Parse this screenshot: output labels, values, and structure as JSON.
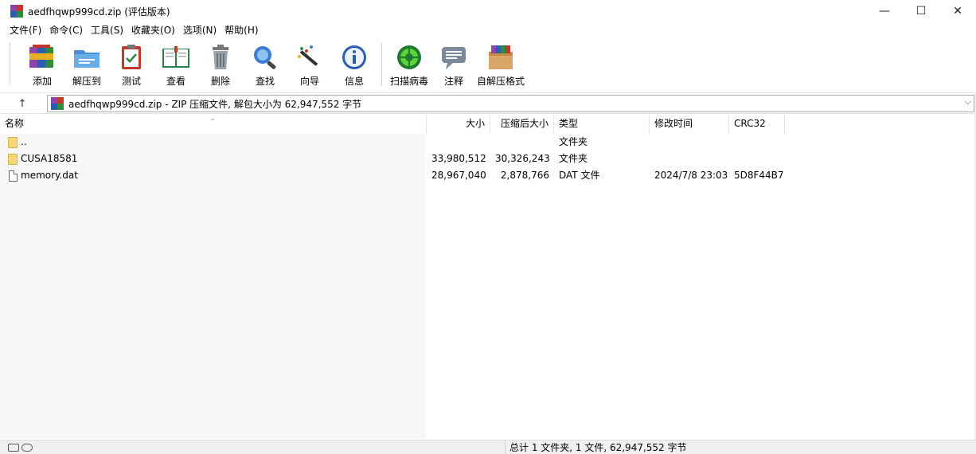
{
  "window": {
    "title": "aedfhqwp999cd.zip (评估版本)",
    "minimize": "—",
    "maximize": "☐",
    "close": "✕"
  },
  "menu": [
    "文件(F)",
    "命令(C)",
    "工具(S)",
    "收藏夹(O)",
    "选项(N)",
    "帮助(H)"
  ],
  "toolbar": {
    "add": "添加",
    "extract": "解压到",
    "test": "测试",
    "view": "查看",
    "delete": "删除",
    "find": "查找",
    "wizard": "向导",
    "info": "信息",
    "scan": "扫描病毒",
    "comment": "注释",
    "sfx": "自解压格式"
  },
  "address": {
    "up": "↑",
    "text": "aedfhqwp999cd.zip - ZIP 压缩文件, 解包大小为 62,947,552 字节",
    "dropdown": "⌵"
  },
  "columns": {
    "name": "名称",
    "size": "大小",
    "packed": "压缩后大小",
    "type": "类型",
    "modified": "修改时间",
    "crc": "CRC32"
  },
  "rows": [
    {
      "name": "..",
      "size": "",
      "packed": "",
      "type": "文件夹",
      "modified": "",
      "crc": "",
      "kind": "folder"
    },
    {
      "name": "CUSA18581",
      "size": "33,980,512",
      "packed": "30,326,243",
      "type": "文件夹",
      "modified": "",
      "crc": "",
      "kind": "folder"
    },
    {
      "name": "memory.dat",
      "size": "28,967,040",
      "packed": "2,878,766",
      "type": "DAT 文件",
      "modified": "2024/7/8 23:03",
      "crc": "5D8F44B7",
      "kind": "file"
    }
  ],
  "status": {
    "text": "总计 1 文件夹, 1 文件, 62,947,552 字节"
  },
  "colors": {
    "rar_red": "#c0392b",
    "rar_green": "#2e8b3e",
    "rar_blue": "#2a5db0",
    "rar_yellow": "#e8b020"
  }
}
